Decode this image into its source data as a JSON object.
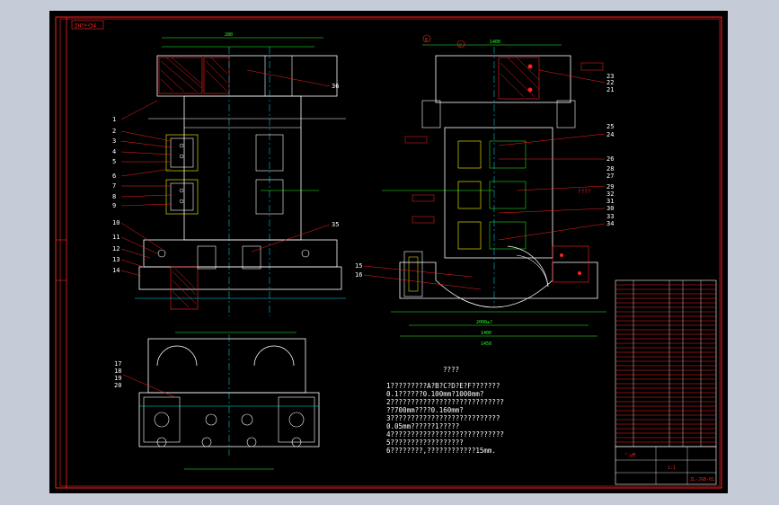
{
  "title_block": {
    "drawing_tag": "IH\"\u001234",
    "scale": "1:1",
    "part_label": "³´µ¶",
    "code": "ZL-JGB-01"
  },
  "notes": {
    "heading": "????",
    "lines": [
      "1?????????A?B?C?D?E?F???????",
      "  0.1??????0.100mm?1000mm?",
      "2????????????????????????????",
      "  ??700mm????0.160mm?",
      "3???????????????????????????",
      "  0.05mm??????1?????",
      "4????????????????????????????",
      "5??????????????????",
      "6????????,????????????15mm."
    ]
  },
  "balloons_left": [
    "1",
    "2",
    "3",
    "4",
    "5",
    "6",
    "7",
    "8",
    "9",
    "10",
    "11",
    "12",
    "13",
    "14"
  ],
  "balloons_top": "36",
  "balloon_35": "35",
  "balloons_bottom": [
    "17",
    "18",
    "19",
    "20"
  ],
  "balloons_right_top": [
    "23",
    "22",
    "21"
  ],
  "balloons_right_mid": [
    "25",
    "24",
    "26",
    "28",
    "27",
    "29",
    "32",
    "31",
    "30",
    "33",
    "34"
  ],
  "balloons_right_low": [
    "15",
    "16"
  ],
  "cross_ref": "????",
  "datum_labels": [
    "B",
    "C"
  ],
  "dims": {
    "top_total": "280",
    "right_total": "1400",
    "right_bottom_1": "2000±?",
    "right_bottom_2": "1400",
    "right_bottom_3": "1450"
  },
  "colors": {
    "background": "#000000",
    "border": "#ff2020",
    "geometry": "#ffffff",
    "dimension": "#28ff28",
    "center": "#00e6ff",
    "hidden": "#ffff00",
    "hatch": "#ff2020"
  }
}
